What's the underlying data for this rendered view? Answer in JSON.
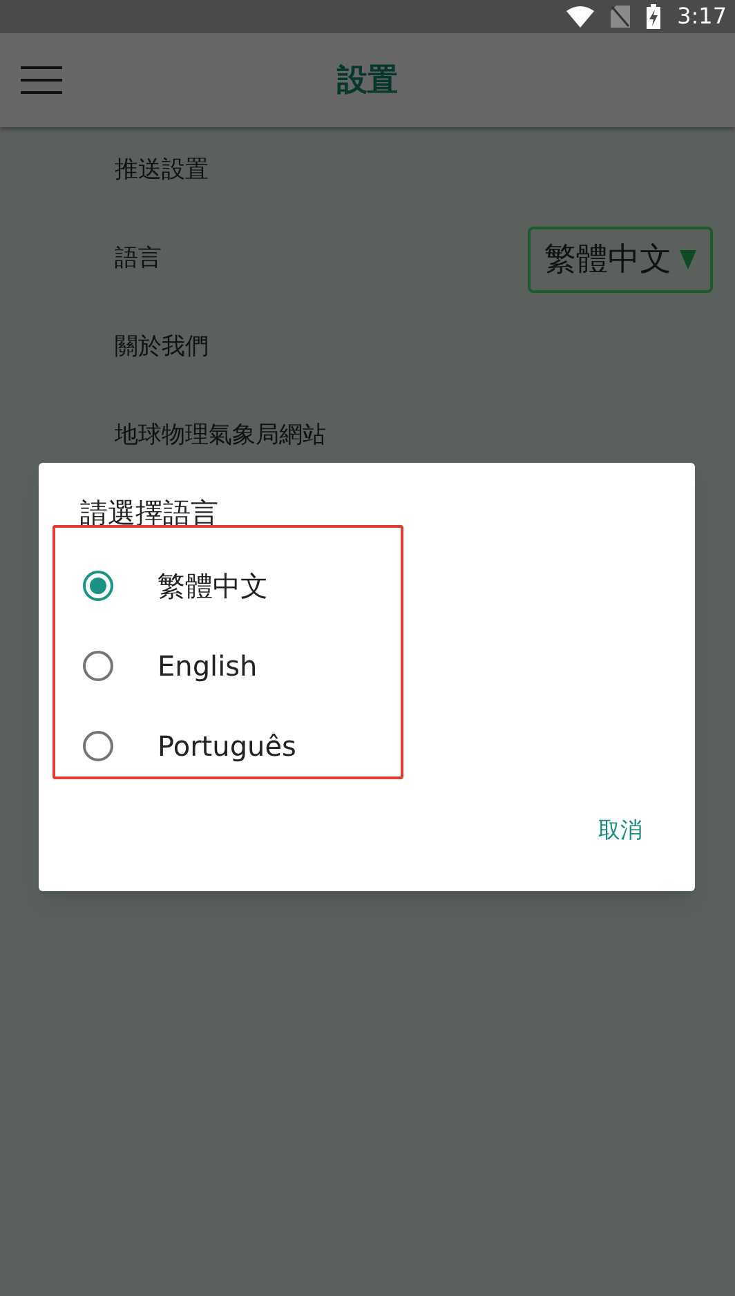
{
  "status_bar": {
    "time": "3:17"
  },
  "app_bar": {
    "title": "設置"
  },
  "settings": [
    {
      "label": "推送設置",
      "kind": "plain"
    },
    {
      "label": "語言",
      "kind": "dropdown",
      "value": "繁體中文"
    },
    {
      "label": "關於我們",
      "kind": "plain"
    },
    {
      "label": "地球物理氣象局網站",
      "kind": "plain"
    }
  ],
  "dialog": {
    "title": "請選擇語言",
    "options": [
      {
        "label": "繁體中文",
        "selected": true
      },
      {
        "label": "English",
        "selected": false
      },
      {
        "label": "Português",
        "selected": false
      }
    ],
    "buttons": [
      "取消"
    ]
  },
  "annotation": {
    "color": "#e53935"
  }
}
